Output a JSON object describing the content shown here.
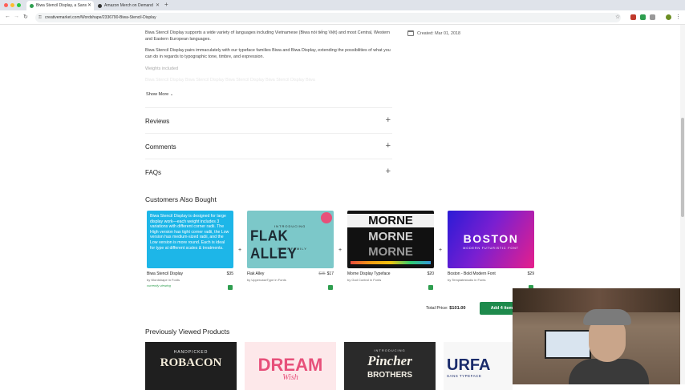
{
  "browser": {
    "tabs": [
      {
        "title": "Biwa Stencil Display, a Sans",
        "active": true
      },
      {
        "title": "Amazon Merch on Demand",
        "active": false
      }
    ],
    "url": "creativemarket.com/Wordshape/2336790-Biwa-Stencil-Display"
  },
  "product": {
    "description_paragraphs": [
      "Biwa Stencil Display supports a wide variety of languages including Vietnamese (Biwa nói tiếng Việt) and most Central, Western and Eastern European languages.",
      "Biwa Stencil Display pairs immaculately with our typeface families Biwa and Biwa Display, extending the possibilities of what you can do in regards to typographic tone, timbre, and expression.",
      "Weights included"
    ],
    "faded_line": "Biwa Stencil Display Biwa Stencil Display Biwa Stencil Display Biwa Stencil Display Biwa",
    "show_more": "Show More",
    "created": "Created: Mar 01, 2018"
  },
  "sections": [
    {
      "label": "Reviews"
    },
    {
      "label": "Comments"
    },
    {
      "label": "FAQs"
    }
  ],
  "also_bought": {
    "heading": "Customers Also Bought",
    "items": [
      {
        "name": "Biwa Stencil Display",
        "price": "$35",
        "old_price": "",
        "by": "by Wordshape in Fonts",
        "status": "currently viewing",
        "thumb_text": "Biwa Stencil Display is designed for large display work—each weight includes 3 variations with different corner radii. The High version has tight corner radii, the Low version has medium-sized radii, and the Low version is more round. Each is ideal for type at different scales & treatments."
      },
      {
        "name": "Flak Alley",
        "price": "$17",
        "old_price": "$35",
        "by": "by UppercaseType in Fonts",
        "status": "",
        "thumb_text": "FLAK ALLEY",
        "thumb_sub": "FONT FAMILY",
        "thumb_intro": "INTRODUCING"
      },
      {
        "name": "Morne Display Typeface",
        "price": "$20",
        "old_price": "",
        "by": "by God Control in Fonts",
        "status": "",
        "thumb_text": "MORNE"
      },
      {
        "name": "Boston - Bold Modern Font",
        "price": "$29",
        "old_price": "",
        "by": "by Templatestudio in Fonts",
        "status": "",
        "thumb_text": "BOSTON",
        "thumb_sub": "MODERN FUTURISTIC FONT"
      }
    ],
    "total_label": "Total Price:",
    "total_value": "$101.00",
    "add_button": "Add 4 items"
  },
  "previously_viewed": {
    "heading": "Previously Viewed Products",
    "items": [
      {
        "title": "ROBACON",
        "sub": "HANDPICKED"
      },
      {
        "title": "DREAM",
        "sub": "Wish"
      },
      {
        "title": "Pincher",
        "sub": "BROTHERS",
        "intro": "INTRODUCING"
      },
      {
        "title": "URFA",
        "sub": "SANS TYPEFACE"
      }
    ]
  },
  "colors": {
    "accent_green": "#1e8a4c",
    "check_green": "#2e9e4f"
  }
}
